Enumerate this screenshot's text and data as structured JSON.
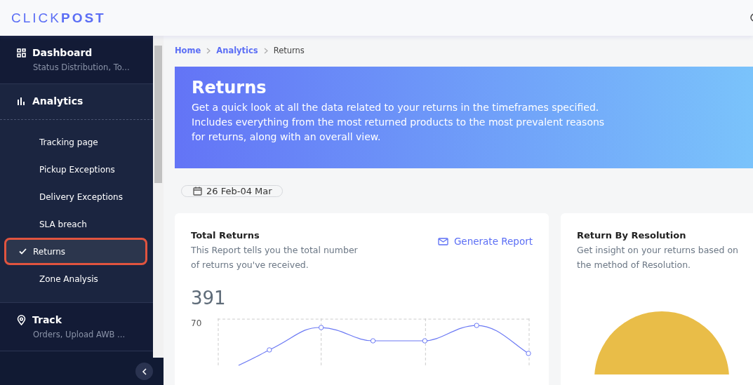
{
  "header": {
    "logo_light": "CLICK",
    "logo_bold": "POST"
  },
  "sidebar": {
    "sections": [
      {
        "kind": "grid",
        "label": "Dashboard",
        "subtitle": "Status Distribution, To..."
      },
      {
        "kind": "bars",
        "label": "Analytics",
        "expanded": true,
        "items": [
          {
            "label": "Tracking page",
            "selected": false
          },
          {
            "label": "Pickup Exceptions",
            "selected": false
          },
          {
            "label": "Delivery Exceptions",
            "selected": false
          },
          {
            "label": "SLA breach",
            "selected": false
          },
          {
            "label": "Returns",
            "selected": true
          },
          {
            "label": "Zone Analysis",
            "selected": false
          }
        ]
      },
      {
        "kind": "pin",
        "label": "Track",
        "subtitle": "Orders, Upload AWB ..."
      }
    ]
  },
  "breadcrumb": [
    {
      "label": "Home",
      "link": true
    },
    {
      "label": "Analytics",
      "link": true
    },
    {
      "label": "Returns",
      "link": false
    }
  ],
  "banner": {
    "title": "Returns",
    "text": "Get a quick look at all the data related to your returns in the timeframes specified. Includes everything from the most returned products to the most prevalent reasons for returns, along with an overall view."
  },
  "date_range": "26 Feb-04 Mar",
  "cards": [
    {
      "kind": "line",
      "title": "Total Returns",
      "description": "This Report tells you the total number of returns you've received.",
      "action": "Generate Report",
      "total": "391",
      "y_tick": "70"
    },
    {
      "kind": "pie",
      "title": "Return By Resolution",
      "description": "Get insight on your returns based on the method of Resolution."
    }
  ]
}
